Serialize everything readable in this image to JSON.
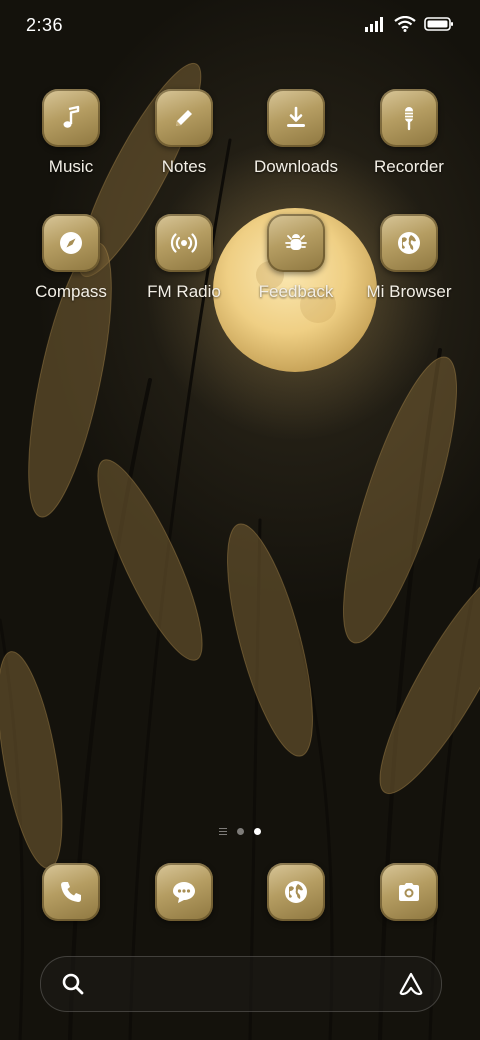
{
  "status_bar": {
    "time": "2:36"
  },
  "apps": [
    {
      "label": "Music",
      "icon": "music-note-icon"
    },
    {
      "label": "Notes",
      "icon": "pencil-icon"
    },
    {
      "label": "Downloads",
      "icon": "download-icon"
    },
    {
      "label": "Recorder",
      "icon": "microphone-icon"
    },
    {
      "label": "Compass",
      "icon": "compass-icon"
    },
    {
      "label": "FM Radio",
      "icon": "radio-broadcast-icon"
    },
    {
      "label": "Feedback",
      "icon": "bug-icon"
    },
    {
      "label": "Mi Browser",
      "icon": "globe-icon"
    }
  ],
  "dock": [
    {
      "icon": "phone-icon"
    },
    {
      "icon": "message-icon"
    },
    {
      "icon": "globe-icon"
    },
    {
      "icon": "camera-icon"
    }
  ],
  "page_indicator": {
    "pages": 2,
    "active": 2
  },
  "colors": {
    "tile": "#b59d62",
    "moon": "#f2d58f",
    "label": "#f3efe6"
  }
}
